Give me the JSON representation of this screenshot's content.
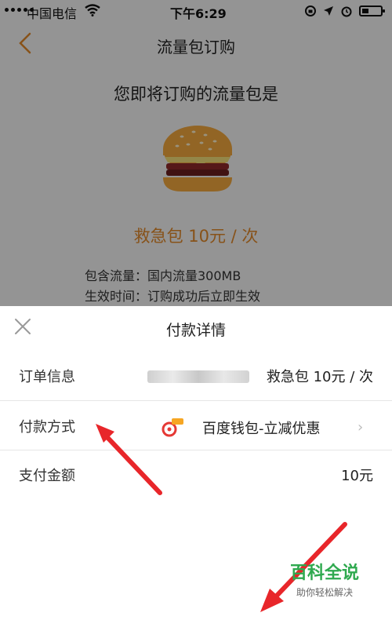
{
  "status_bar": {
    "carrier": "中国电信",
    "time": "下午6:29"
  },
  "header": {
    "title": "流量包订购"
  },
  "main": {
    "subtitle": "您即将订购的流量包是",
    "package_name": "救急包 10元 / 次",
    "details": [
      "包含流量：国内流量300MB",
      "生效时间：订购成功后立即生效"
    ]
  },
  "sheet": {
    "title": "付款详情",
    "rows": [
      {
        "label": "订单信息",
        "value": "救急包 10元 / 次"
      },
      {
        "label": "付款方式",
        "value": "百度钱包-立减优惠"
      },
      {
        "label": "支付金额",
        "value": "10元"
      }
    ]
  },
  "watermark": {
    "main": "百科全说",
    "sub": "助你轻松解决"
  },
  "colors": {
    "accent": "#e2892b",
    "arrow": "#e8262a",
    "watermark": "#2fa94f"
  }
}
